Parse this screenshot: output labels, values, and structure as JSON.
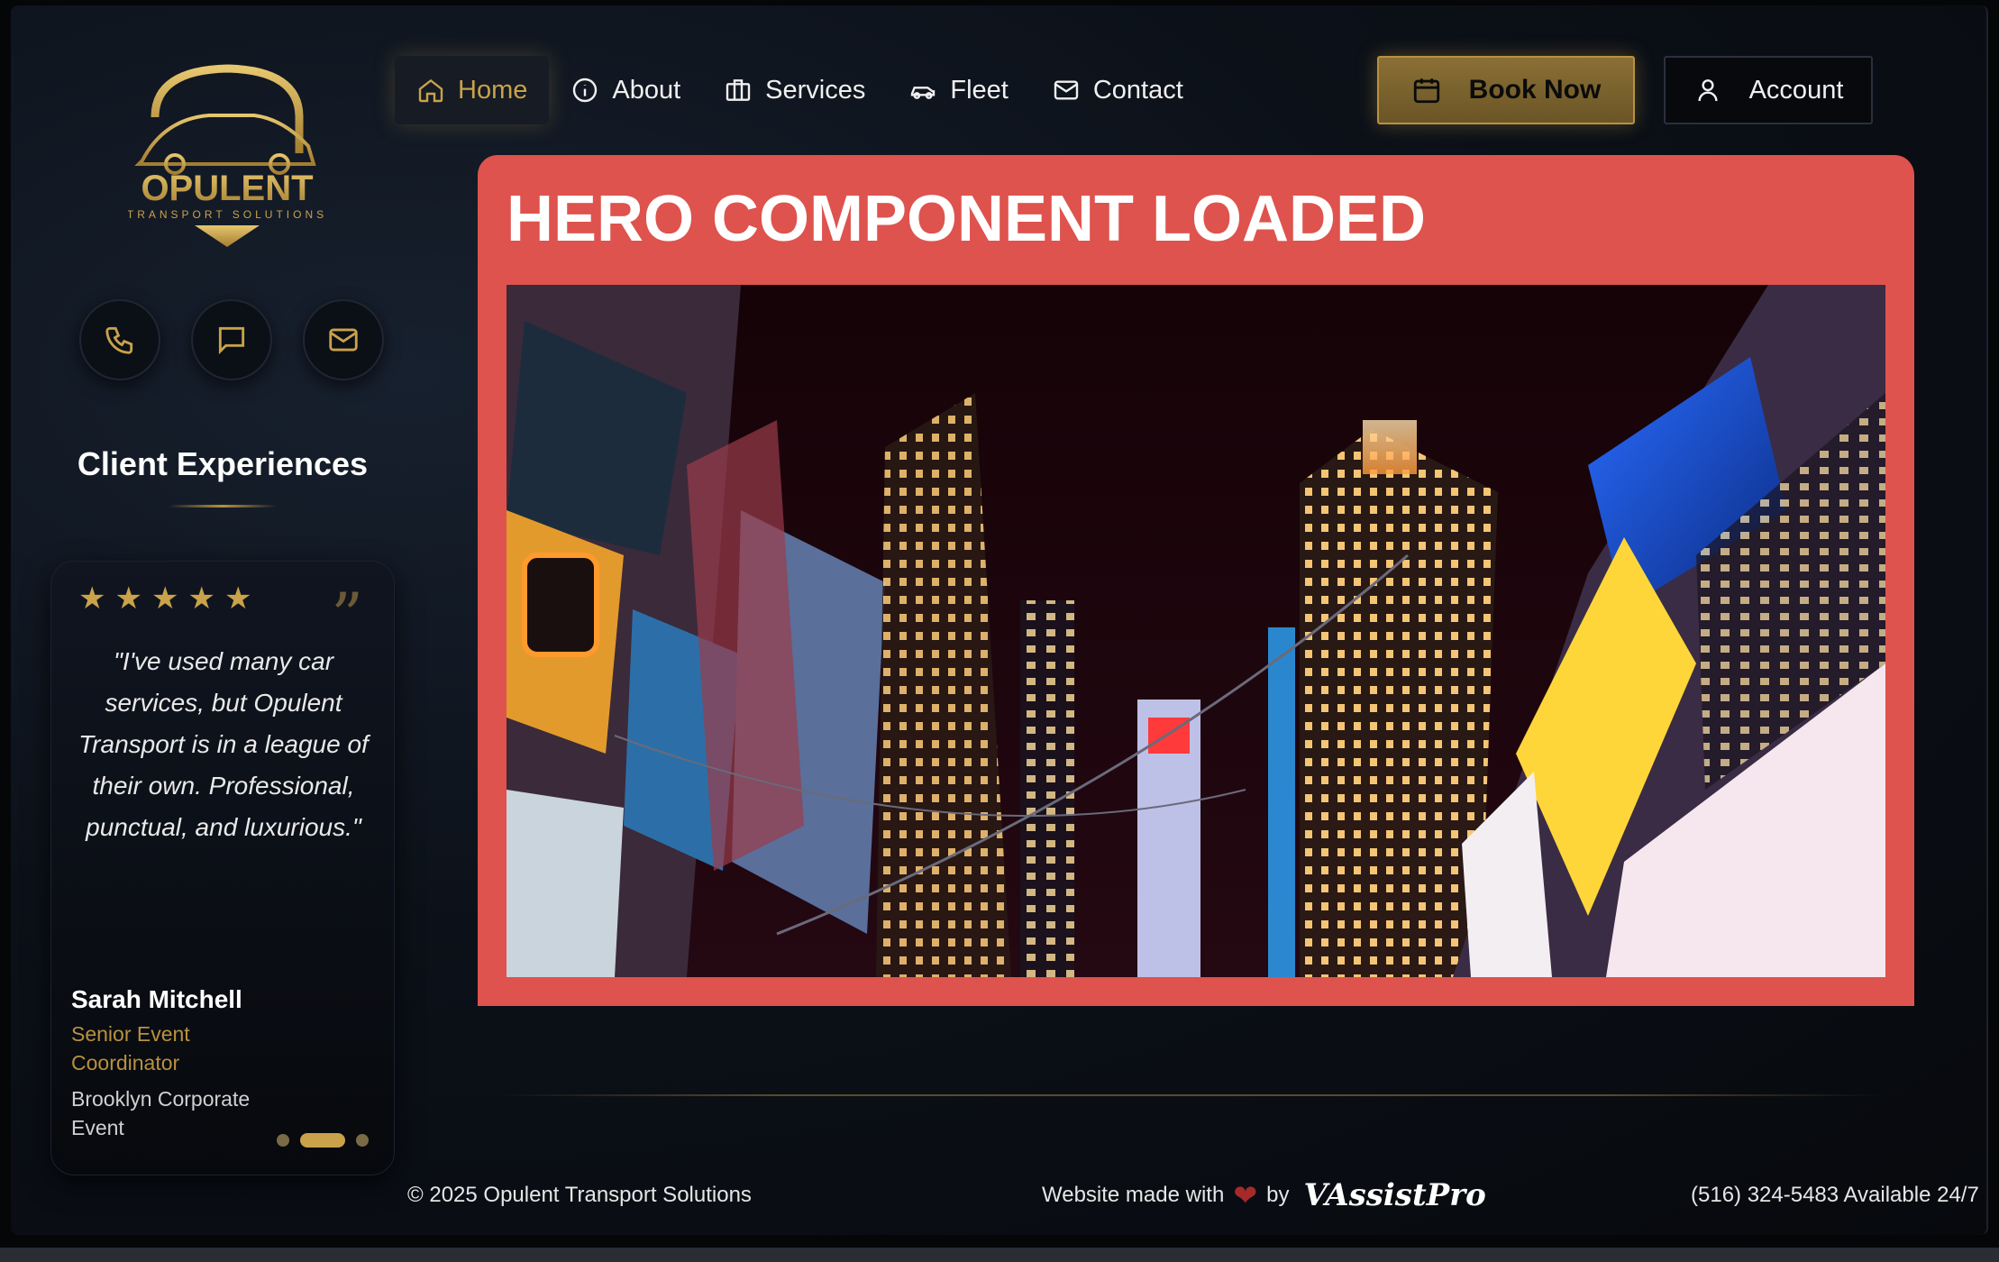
{
  "brand": {
    "logo_name": "OPULENT",
    "logo_tagline": "TRANSPORT SOLUTIONS",
    "gold": "#c9a24a"
  },
  "sidebar": {
    "contact_icons": [
      "phone-icon",
      "chat-icon",
      "mail-icon"
    ],
    "title": "Client Experiences",
    "testimonial": {
      "rating": 5,
      "quote": "\"I've used many car services, but Opulent Transport is in a league of their own. Professional, punctual, and luxurious.\"",
      "author": "Sarah Mitchell",
      "role": "Senior Event Coordinator",
      "location": "Brooklyn Corporate Event",
      "slide_count": 3,
      "active_slide": 2
    }
  },
  "nav": {
    "items": [
      {
        "label": "Home",
        "icon": "home-icon",
        "active": true
      },
      {
        "label": "About",
        "icon": "info-icon",
        "active": false
      },
      {
        "label": "Services",
        "icon": "briefcase-icon",
        "active": false
      },
      {
        "label": "Fleet",
        "icon": "car-icon",
        "active": false
      },
      {
        "label": "Contact",
        "icon": "mail-icon",
        "active": false
      }
    ],
    "book_label": "Book Now",
    "account_label": "Account"
  },
  "hero": {
    "title": "HERO COMPONENT LOADED",
    "background_color": "#de534d",
    "image_alt": "city-night-billboards"
  },
  "footer": {
    "copyright": "© 2025 Opulent Transport Solutions",
    "made_with": "Website made with",
    "by": "by",
    "credit": "VAssistPro",
    "contact": "(516) 324-5483 Available 24/7"
  }
}
